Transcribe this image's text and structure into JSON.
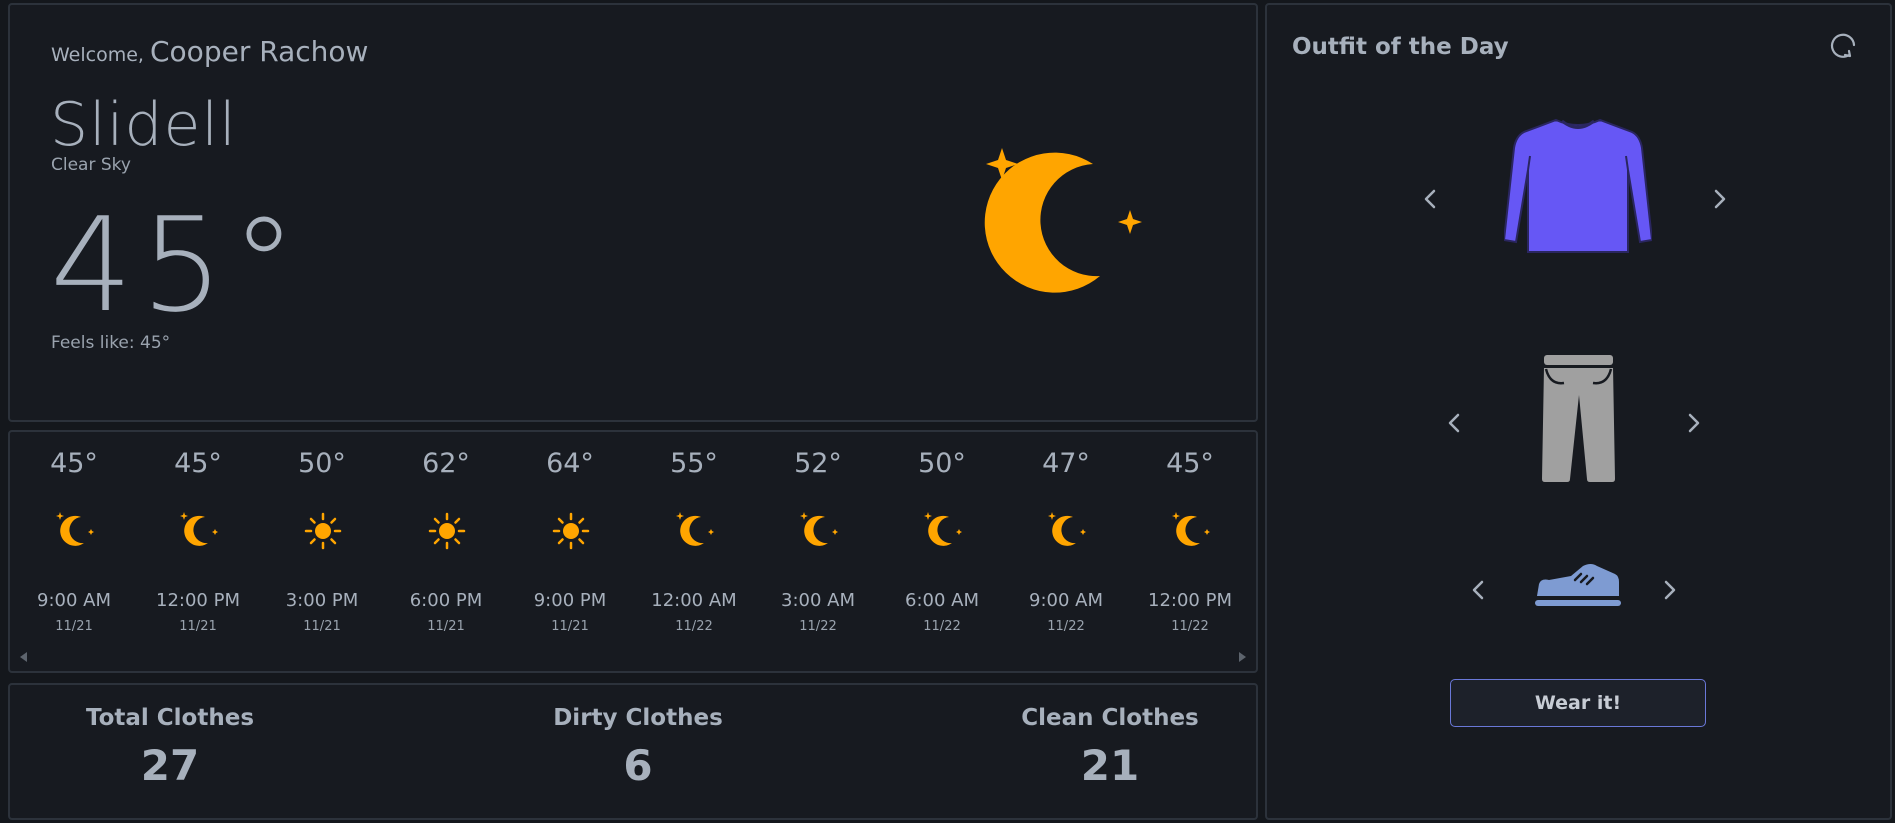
{
  "weather": {
    "welcome_prefix": "Welcome,",
    "user_name": "Cooper Rachow",
    "city": "Slidell",
    "condition": "Clear Sky",
    "temperature": "45°",
    "feels_like": "Feels like: 45°",
    "icon": "moon-stars-icon",
    "accent_color": "#ffa500"
  },
  "forecast": [
    {
      "temp": "45°",
      "time": "9:00 AM",
      "date": "11/21",
      "icon": "moon-icon"
    },
    {
      "temp": "45°",
      "time": "12:00 PM",
      "date": "11/21",
      "icon": "moon-icon"
    },
    {
      "temp": "50°",
      "time": "3:00 PM",
      "date": "11/21",
      "icon": "sun-icon"
    },
    {
      "temp": "62°",
      "time": "6:00 PM",
      "date": "11/21",
      "icon": "sun-icon"
    },
    {
      "temp": "64°",
      "time": "9:00 PM",
      "date": "11/21",
      "icon": "sun-icon"
    },
    {
      "temp": "55°",
      "time": "12:00 AM",
      "date": "11/22",
      "icon": "moon-icon"
    },
    {
      "temp": "52°",
      "time": "3:00 AM",
      "date": "11/22",
      "icon": "moon-icon"
    },
    {
      "temp": "50°",
      "time": "6:00 AM",
      "date": "11/22",
      "icon": "moon-icon"
    },
    {
      "temp": "47°",
      "time": "9:00 AM",
      "date": "11/22",
      "icon": "moon-icon"
    },
    {
      "temp": "45°",
      "time": "12:00 PM",
      "date": "11/22",
      "icon": "moon-icon"
    }
  ],
  "stats": {
    "total_label": "Total Clothes",
    "total_value": "27",
    "dirty_label": "Dirty Clothes",
    "dirty_value": "6",
    "clean_label": "Clean Clothes",
    "clean_value": "21"
  },
  "outfit": {
    "title": "Outfit of the Day",
    "top_icon": "long-sleeve-shirt-icon",
    "top_color": "#6657f5",
    "bottom_icon": "pants-icon",
    "bottom_color": "#a0a0a0",
    "shoes_icon": "sneaker-icon",
    "shoes_color": "#7e9bd2",
    "wear_button_label": "Wear it!"
  }
}
